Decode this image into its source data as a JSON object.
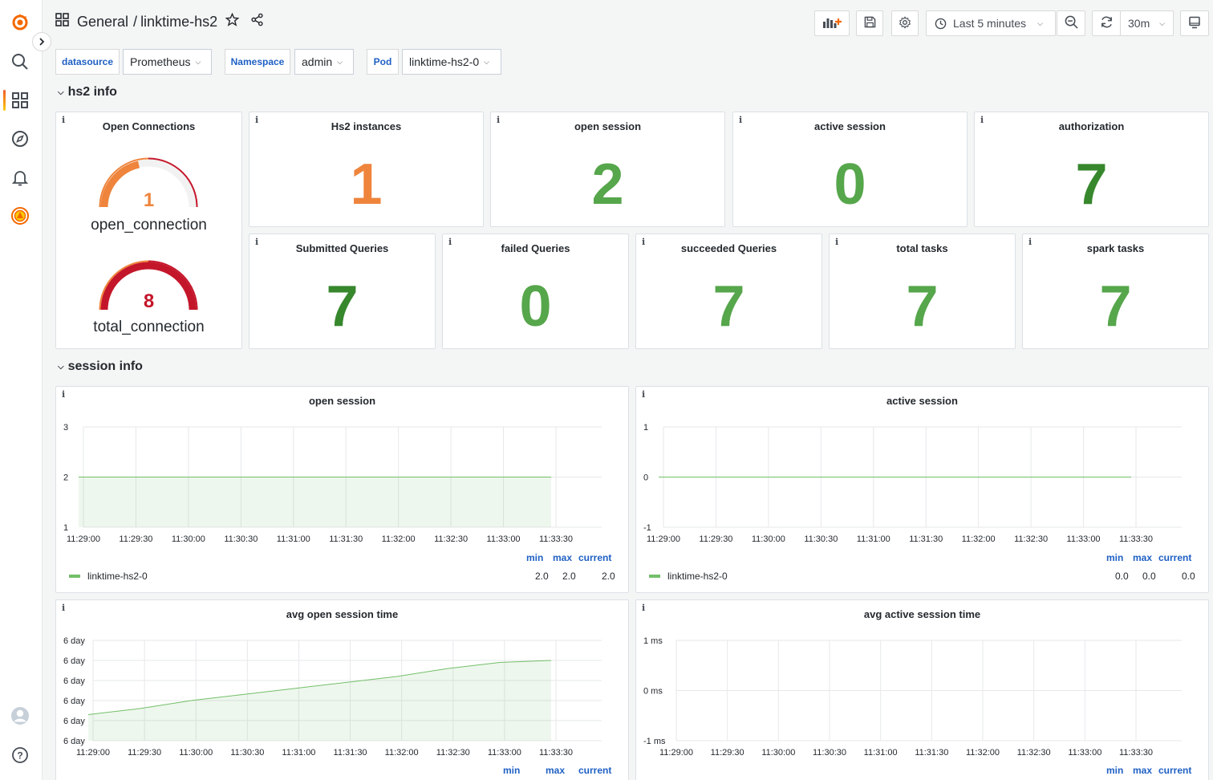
{
  "breadcrumb": {
    "folder": "General",
    "separator": "/",
    "dashboard": "linktime-hs2"
  },
  "toolbar": {
    "time_range": "Last 5 minutes",
    "refresh_interval": "30m"
  },
  "variables": [
    {
      "label": "datasource",
      "value": "Prometheus"
    },
    {
      "label": "Namespace",
      "value": "admin"
    },
    {
      "label": "Pod",
      "value": "linktime-hs2-0"
    }
  ],
  "rows": {
    "hs2": "hs2 info",
    "session": "session info"
  },
  "colors": {
    "green": "#56a64b",
    "orange": "#ef843c",
    "dark_green": "#37872d",
    "red": "#c4162a",
    "link": "#1f60c4"
  },
  "gauges": {
    "title": "Open Connections",
    "open": {
      "value": "1",
      "label": "open_connection",
      "color": "#ef843c"
    },
    "total": {
      "value": "8",
      "label": "total_connection",
      "color": "#c4162a"
    }
  },
  "stats": [
    {
      "title": "Hs2 instances",
      "value": "1",
      "color": "#ef843c"
    },
    {
      "title": "open session",
      "value": "2",
      "color": "#56a64b"
    },
    {
      "title": "active session",
      "value": "0",
      "color": "#56a64b"
    },
    {
      "title": "authorization",
      "value": "7",
      "color": "#37872d"
    },
    {
      "title": "Submitted Queries",
      "value": "7",
      "color": "#37872d"
    },
    {
      "title": "failed Queries",
      "value": "0",
      "color": "#56a64b"
    },
    {
      "title": "succeeded Queries",
      "value": "7",
      "color": "#56a64b"
    },
    {
      "title": "total tasks",
      "value": "7",
      "color": "#56a64b"
    },
    {
      "title": "spark tasks",
      "value": "7",
      "color": "#56a64b"
    }
  ],
  "legend_headers": {
    "min": "min",
    "max": "max",
    "current": "current"
  },
  "chart_data": [
    {
      "type": "area",
      "title": "open session",
      "x": [
        "11:29:00",
        "11:29:30",
        "11:30:00",
        "11:30:30",
        "11:31:00",
        "11:31:30",
        "11:32:00",
        "11:32:30",
        "11:33:00",
        "11:33:30"
      ],
      "yticks": [
        "3",
        "2",
        "1"
      ],
      "ylim": [
        1,
        3
      ],
      "series": [
        {
          "name": "linktime-hs2-0",
          "values": [
            2,
            2,
            2,
            2,
            2,
            2,
            2,
            2,
            2,
            2
          ],
          "min": "2.0",
          "max": "2.0",
          "current": "2.0"
        }
      ]
    },
    {
      "type": "line",
      "title": "active session",
      "x": [
        "11:29:00",
        "11:29:30",
        "11:30:00",
        "11:30:30",
        "11:31:00",
        "11:31:30",
        "11:32:00",
        "11:32:30",
        "11:33:00",
        "11:33:30"
      ],
      "yticks": [
        "1",
        "0",
        "-1"
      ],
      "ylim": [
        -1,
        1
      ],
      "series": [
        {
          "name": "linktime-hs2-0",
          "values": [
            0,
            0,
            0,
            0,
            0,
            0,
            0,
            0,
            0,
            0
          ],
          "min": "0.0",
          "max": "0.0",
          "current": "0.0"
        }
      ]
    },
    {
      "type": "area",
      "title": "avg open session time",
      "x": [
        "11:29:00",
        "11:29:30",
        "11:30:00",
        "11:30:30",
        "11:31:00",
        "11:31:30",
        "11:32:00",
        "11:32:30",
        "11:33:00",
        "11:33:30"
      ],
      "yticks": [
        "6 day",
        "6 day",
        "6 day",
        "6 day",
        "6 day",
        "6 day"
      ],
      "ylim": [
        0,
        5
      ],
      "series": [
        {
          "values": [
            1.3,
            1.6,
            2.0,
            2.3,
            2.6,
            2.9,
            3.2,
            3.6,
            3.9,
            4.0
          ]
        }
      ]
    },
    {
      "type": "line",
      "title": "avg active session time",
      "x": [
        "11:29:00",
        "11:29:30",
        "11:30:00",
        "11:30:30",
        "11:31:00",
        "11:31:30",
        "11:32:00",
        "11:32:30",
        "11:33:00",
        "11:33:30"
      ],
      "yticks": [
        "1 ms",
        "0 ms",
        "-1 ms"
      ],
      "ylim": [
        -1,
        1
      ],
      "series": []
    }
  ]
}
